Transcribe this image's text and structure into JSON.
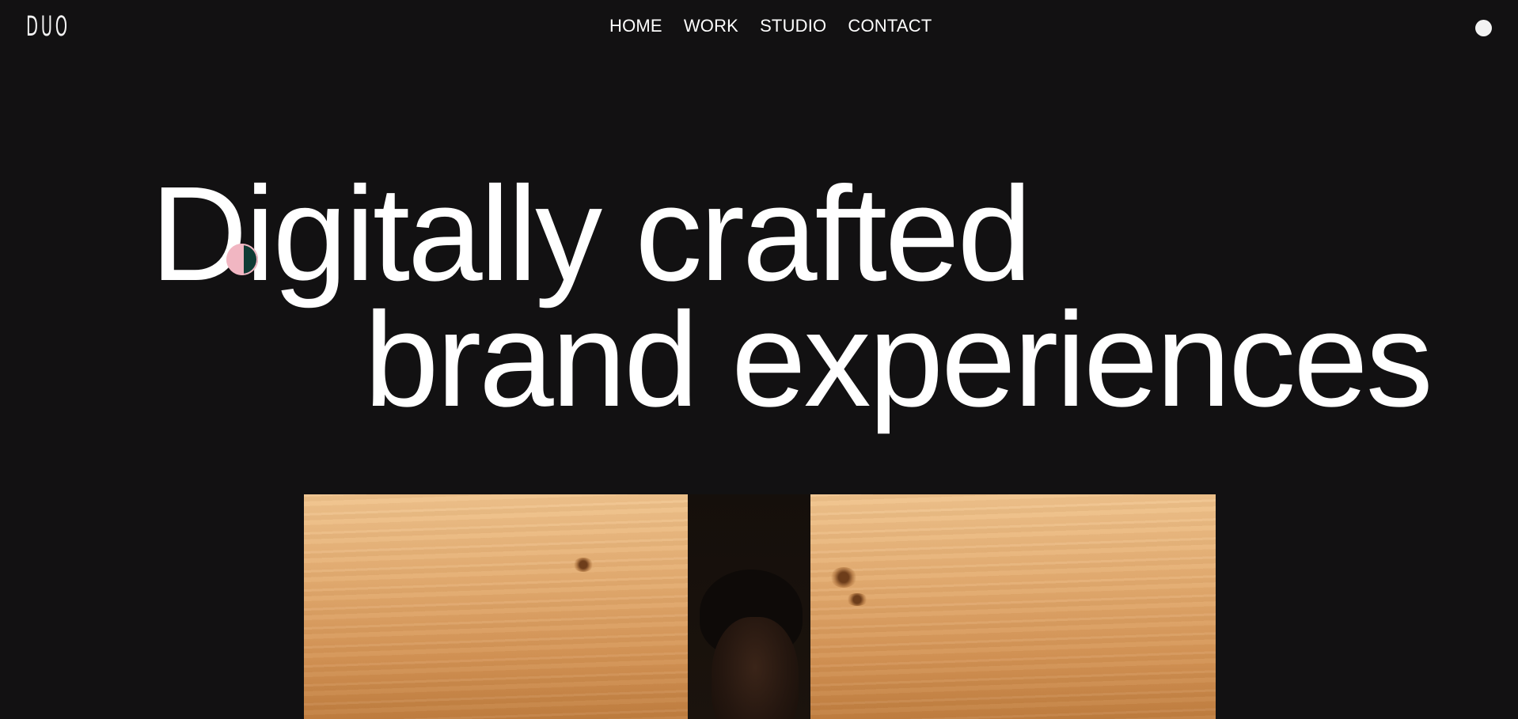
{
  "header": {
    "logo": "DUO",
    "nav": [
      {
        "label": "HOME"
      },
      {
        "label": "WORK"
      },
      {
        "label": "STUDIO"
      },
      {
        "label": "CONTACT"
      }
    ],
    "menu_icon": "circle-menu-icon"
  },
  "hero": {
    "line1": "Digitally crafted",
    "line2": "brand experiences"
  },
  "showcase": {
    "image": "wooden boards with person peeking through gap"
  },
  "colors": {
    "background": "#121112",
    "text": "#ffffff",
    "cursor_pink": "#f1b6c2",
    "cursor_green": "#0f3b34",
    "wood": "#e4ad72"
  }
}
